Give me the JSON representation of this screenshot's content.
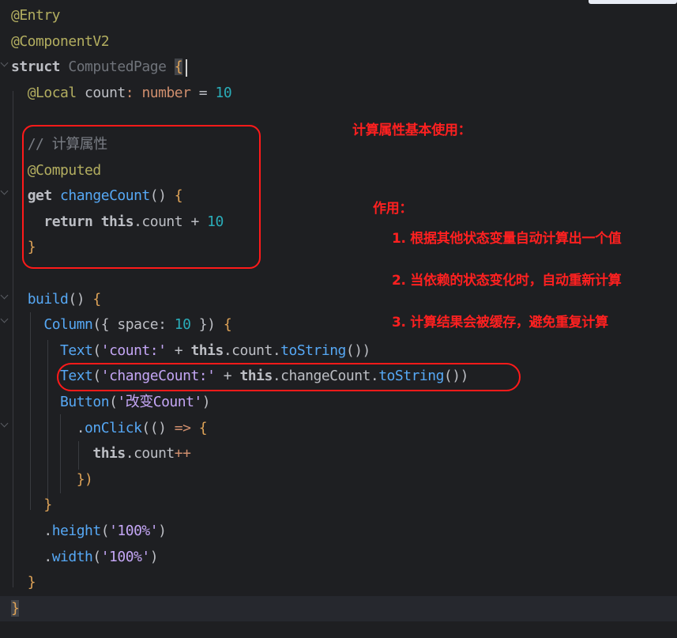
{
  "editor": {
    "lines": [
      {
        "parts": [
          {
            "c": "t-ann",
            "t": "@Entry"
          }
        ]
      },
      {
        "parts": [
          {
            "c": "t-ann",
            "t": "@ComponentV2"
          }
        ]
      },
      {
        "parts": [
          {
            "c": "t-kwc",
            "t": "struct "
          },
          {
            "c": "t-cls",
            "t": "ComputedPage "
          },
          {
            "c": "brace-hl",
            "t": "{"
          }
        ]
      },
      {
        "parts": [
          {
            "c": "t-plain",
            "t": "  "
          },
          {
            "c": "t-ann",
            "t": "@Local"
          },
          {
            "c": "t-plain",
            "t": " count"
          },
          {
            "c": "t-kwn",
            "t": ": "
          },
          {
            "c": "t-kwn",
            "t": "number"
          },
          {
            "c": "t-plain",
            "t": " = "
          },
          {
            "c": "t-num",
            "t": "10"
          }
        ]
      },
      {
        "parts": [
          {
            "c": "t-plain",
            "t": ""
          }
        ]
      },
      {
        "parts": [
          {
            "c": "t-plain",
            "t": "  "
          },
          {
            "c": "t-cmt",
            "t": "// 计算属性"
          }
        ]
      },
      {
        "parts": [
          {
            "c": "t-plain",
            "t": "  "
          },
          {
            "c": "t-ann",
            "t": "@Computed"
          }
        ]
      },
      {
        "parts": [
          {
            "c": "t-plain",
            "t": "  "
          },
          {
            "c": "t-kwc",
            "t": "get "
          },
          {
            "c": "t-fn",
            "t": "changeCount"
          },
          {
            "c": "t-plain",
            "t": "() "
          },
          {
            "c": "t-brace",
            "t": "{"
          }
        ]
      },
      {
        "parts": [
          {
            "c": "t-plain",
            "t": "    "
          },
          {
            "c": "t-kwc",
            "t": "return "
          },
          {
            "c": "t-kwc",
            "t": "this"
          },
          {
            "c": "t-plain",
            "t": ".count "
          },
          {
            "c": "t-plain",
            "t": "+ "
          },
          {
            "c": "t-num",
            "t": "10"
          }
        ]
      },
      {
        "parts": [
          {
            "c": "t-plain",
            "t": "  "
          },
          {
            "c": "t-brace",
            "t": "}"
          }
        ]
      },
      {
        "parts": [
          {
            "c": "t-plain",
            "t": ""
          }
        ]
      },
      {
        "parts": [
          {
            "c": "t-plain",
            "t": "  "
          },
          {
            "c": "t-fn",
            "t": "build"
          },
          {
            "c": "t-plain",
            "t": "() "
          },
          {
            "c": "t-brace",
            "t": "{"
          }
        ]
      },
      {
        "parts": [
          {
            "c": "t-plain",
            "t": "    "
          },
          {
            "c": "t-fn",
            "t": "Column"
          },
          {
            "c": "t-plain",
            "t": "({ space: "
          },
          {
            "c": "t-num",
            "t": "10"
          },
          {
            "c": "t-plain",
            "t": " }) "
          },
          {
            "c": "t-brace",
            "t": "{"
          }
        ]
      },
      {
        "parts": [
          {
            "c": "t-plain",
            "t": "      "
          },
          {
            "c": "t-fn",
            "t": "Text"
          },
          {
            "c": "t-plain",
            "t": "("
          },
          {
            "c": "t-strc",
            "t": "'count:'"
          },
          {
            "c": "t-plain",
            "t": " + "
          },
          {
            "c": "t-kwc",
            "t": "this"
          },
          {
            "c": "t-plain",
            "t": ".count."
          },
          {
            "c": "t-fn",
            "t": "toString"
          },
          {
            "c": "t-plain",
            "t": "())"
          }
        ]
      },
      {
        "parts": [
          {
            "c": "t-plain",
            "t": "      "
          },
          {
            "c": "t-fn",
            "t": "Text"
          },
          {
            "c": "t-plain",
            "t": "("
          },
          {
            "c": "t-strc",
            "t": "'changeCount:'"
          },
          {
            "c": "t-plain",
            "t": " + "
          },
          {
            "c": "t-kwc",
            "t": "this"
          },
          {
            "c": "t-plain",
            "t": ".changeCount."
          },
          {
            "c": "t-fn",
            "t": "toString"
          },
          {
            "c": "t-plain",
            "t": "())"
          }
        ]
      },
      {
        "parts": [
          {
            "c": "t-plain",
            "t": "      "
          },
          {
            "c": "t-fn",
            "t": "Button"
          },
          {
            "c": "t-plain",
            "t": "("
          },
          {
            "c": "t-strc",
            "t": "'改变Count'"
          },
          {
            "c": "t-plain",
            "t": ")"
          }
        ]
      },
      {
        "parts": [
          {
            "c": "t-plain",
            "t": "        ."
          },
          {
            "c": "t-fn",
            "t": "onClick"
          },
          {
            "c": "t-plain",
            "t": "(() "
          },
          {
            "c": "t-kwn",
            "t": "=> "
          },
          {
            "c": "t-brace",
            "t": "{"
          }
        ]
      },
      {
        "parts": [
          {
            "c": "t-plain",
            "t": "          "
          },
          {
            "c": "t-kwc",
            "t": "this"
          },
          {
            "c": "t-plain",
            "t": ".count"
          },
          {
            "c": "t-kwn",
            "t": "++"
          }
        ]
      },
      {
        "parts": [
          {
            "c": "t-plain",
            "t": "        "
          },
          {
            "c": "t-brace",
            "t": "})"
          }
        ]
      },
      {
        "parts": [
          {
            "c": "t-plain",
            "t": "    "
          },
          {
            "c": "t-brace",
            "t": "}"
          }
        ]
      },
      {
        "parts": [
          {
            "c": "t-plain",
            "t": "    ."
          },
          {
            "c": "t-fn",
            "t": "height"
          },
          {
            "c": "t-plain",
            "t": "("
          },
          {
            "c": "t-strc",
            "t": "'100%'"
          },
          {
            "c": "t-plain",
            "t": ")"
          }
        ]
      },
      {
        "parts": [
          {
            "c": "t-plain",
            "t": "    ."
          },
          {
            "c": "t-fn",
            "t": "width"
          },
          {
            "c": "t-plain",
            "t": "("
          },
          {
            "c": "t-strc",
            "t": "'100%'"
          },
          {
            "c": "t-plain",
            "t": ")"
          }
        ]
      },
      {
        "parts": [
          {
            "c": "t-plain",
            "t": "  "
          },
          {
            "c": "t-brace",
            "t": "}"
          }
        ]
      },
      {
        "parts": [
          {
            "c": "brace-hl",
            "t": "}"
          }
        ]
      }
    ]
  },
  "annotations": {
    "title": "计算属性基本使用：",
    "purpose": "作用：",
    "point1": "1. 根据其他状态变量自动计算出一个值",
    "point2": "2. 当依赖的状态变化时，自动重新计算",
    "point3": "3. 计算结果会被缓存，避免重复计算"
  },
  "colors": {
    "background": "#1e1f22",
    "highlight": "#ff1a1a"
  }
}
